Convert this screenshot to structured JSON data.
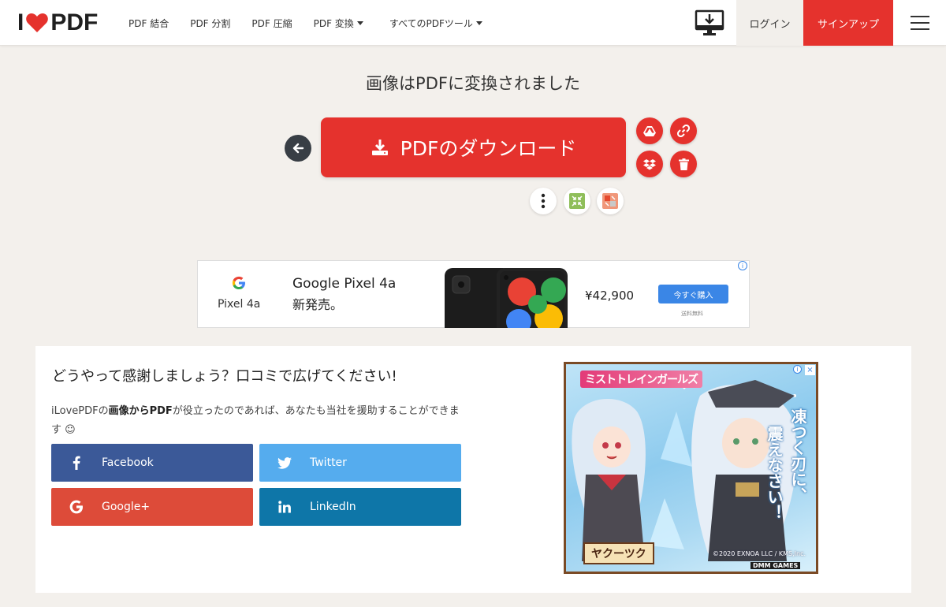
{
  "header": {
    "logo_left": "I",
    "logo_right": "PDF",
    "nav": [
      {
        "label": "PDF 結合"
      },
      {
        "label": "PDF 分割"
      },
      {
        "label": "PDF 圧縮"
      },
      {
        "label": "PDF 変換"
      },
      {
        "label": "すべてのPDFツール"
      }
    ],
    "login": "ログイン",
    "signup": "サインアップ"
  },
  "main": {
    "title": "画像はPDFに変換されました",
    "download_label": "PDFのダウンロード"
  },
  "ad": {
    "brand": "Pixel 4a",
    "headline": "Google Pixel 4a",
    "subline": "新発売。",
    "price": "¥42,900",
    "buy": "今すぐ購入",
    "shipping": "送料無料",
    "info": "i"
  },
  "share": {
    "title": "どうやって感謝しましょう？口コミで広げてください!",
    "desc_pre": "iLovePDFの",
    "desc_bold": "画像からPDF",
    "desc_post": "が役立ったのであれば、あなたも当社を援助することができます ☺",
    "buttons": {
      "facebook": "Facebook",
      "twitter": "Twitter",
      "google": "Google+",
      "linkedin": "LinkedIn"
    }
  },
  "game_ad": {
    "title": "ミストトレインガールズ",
    "slogan_1": "凍つく刃に、",
    "slogan_2": "震えなさい！",
    "character": "ヤクーツク",
    "copyright": "©2020 EXNOA LLC / KMS,Inc.",
    "publisher": "DMM GAMES"
  },
  "colors": {
    "brand_red": "#e5322d",
    "facebook": "#3b5998",
    "twitter": "#55acee",
    "google": "#dd4b39",
    "linkedin": "#0e76a8"
  }
}
